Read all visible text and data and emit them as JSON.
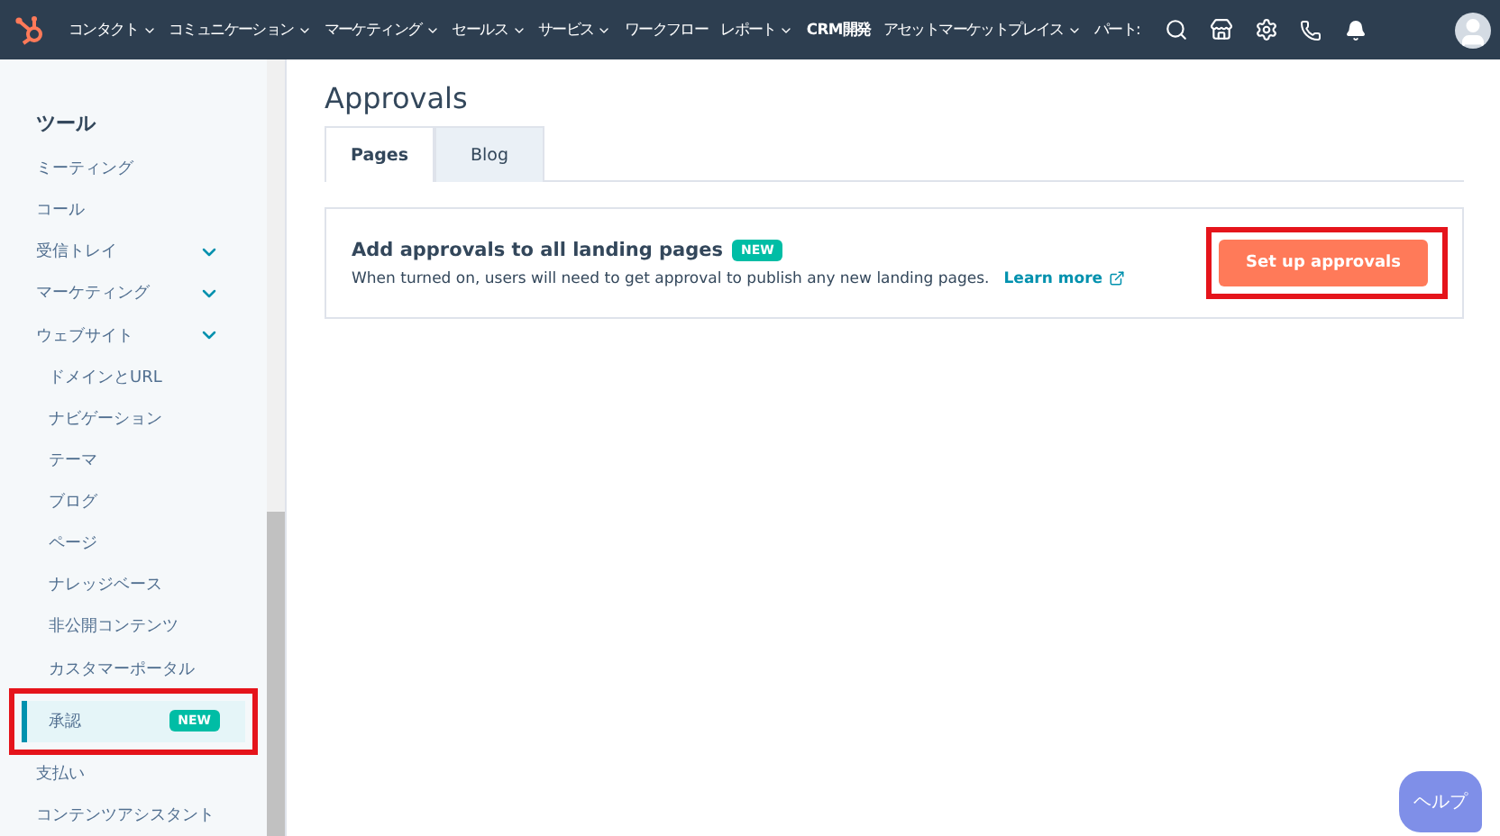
{
  "top_nav": {
    "items": [
      {
        "label": "コンタクト",
        "dropdown": true,
        "bold": false
      },
      {
        "label": "コミュニケーション",
        "dropdown": true,
        "bold": false
      },
      {
        "label": "マーケティング",
        "dropdown": true,
        "bold": false
      },
      {
        "label": "セールス",
        "dropdown": true,
        "bold": false
      },
      {
        "label": "サービス",
        "dropdown": true,
        "bold": false
      },
      {
        "label": "ワークフロー",
        "dropdown": false,
        "bold": false
      },
      {
        "label": "レポート",
        "dropdown": true,
        "bold": false
      },
      {
        "label": "CRM開発",
        "dropdown": false,
        "bold": true
      },
      {
        "label": "アセットマーケットプレイス",
        "dropdown": true,
        "bold": false
      },
      {
        "label": "パート:",
        "dropdown": false,
        "bold": false
      }
    ]
  },
  "sidebar": {
    "heading": "ツール",
    "items": [
      {
        "kind": "item",
        "label": "ミーティング",
        "selected": false
      },
      {
        "kind": "item",
        "label": "コール",
        "selected": false
      },
      {
        "kind": "group",
        "label": "受信トレイ",
        "selected": false
      },
      {
        "kind": "group",
        "label": "マーケティング",
        "selected": false
      },
      {
        "kind": "group",
        "label": "ウェブサイト",
        "selected": false
      },
      {
        "kind": "sub",
        "label": "ドメインとURL",
        "selected": false
      },
      {
        "kind": "sub",
        "label": "ナビゲーション",
        "selected": false
      },
      {
        "kind": "sub",
        "label": "テーマ",
        "selected": false
      },
      {
        "kind": "sub",
        "label": "ブログ",
        "selected": false
      },
      {
        "kind": "sub",
        "label": "ページ",
        "selected": false
      },
      {
        "kind": "sub",
        "label": "ナレッジベース",
        "selected": false
      },
      {
        "kind": "sub",
        "label": "非公開コンテンツ",
        "selected": false
      },
      {
        "kind": "sub",
        "label": "カスタマーポータル",
        "selected": false
      },
      {
        "kind": "sub",
        "label": "承認",
        "selected": true,
        "badge": "NEW",
        "highlighted": true
      },
      {
        "kind": "item",
        "label": "支払い",
        "selected": false
      },
      {
        "kind": "item",
        "label": "コンテンツアシスタント",
        "selected": false
      }
    ]
  },
  "main": {
    "title": "Approvals",
    "tabs": [
      {
        "label": "Pages",
        "selected": true
      },
      {
        "label": "Blog",
        "selected": false
      }
    ],
    "card": {
      "title": "Add approvals to all landing pages",
      "badge": "NEW",
      "description": "When turned on, users will need to get approval to publish any new landing pages.",
      "link": "Learn more",
      "button": {
        "label": "Set up approvals",
        "highlighted": true
      }
    }
  },
  "help_button": "ヘルプ"
}
